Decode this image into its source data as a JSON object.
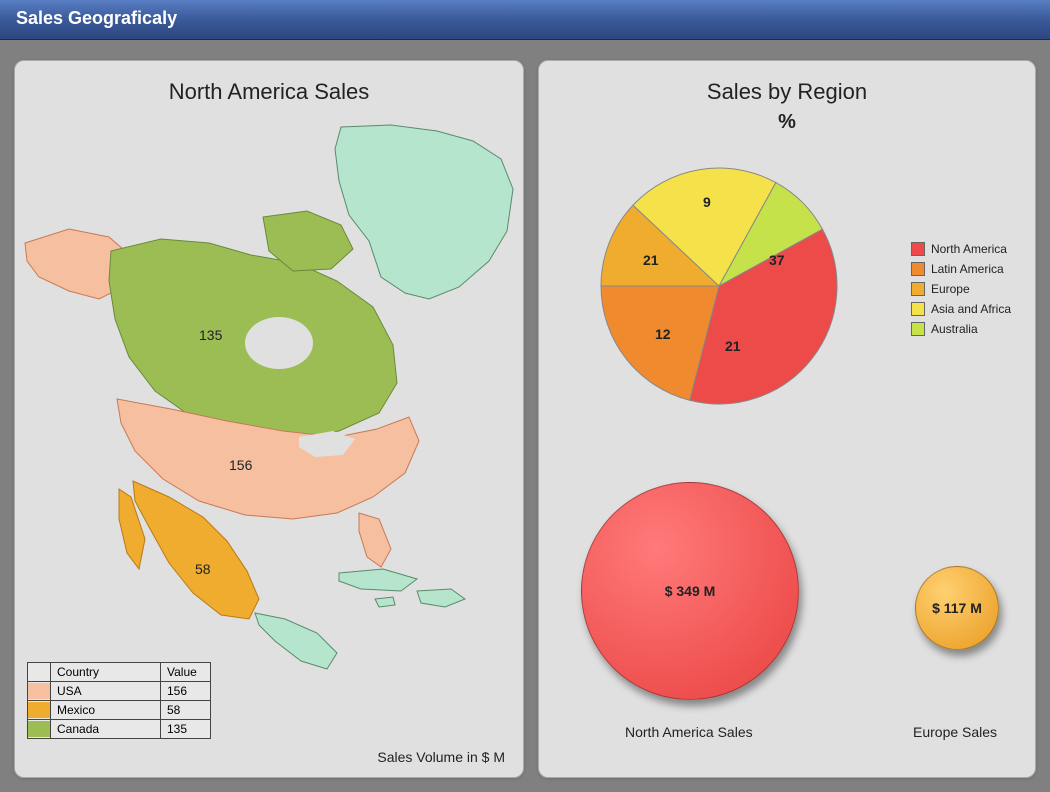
{
  "header": {
    "title": "Sales Geograficaly"
  },
  "map_chart": {
    "title": "North America Sales",
    "caption": "Sales Volume in $ M",
    "countries": [
      {
        "name": "USA",
        "value": 156,
        "color": "#f5bfa0"
      },
      {
        "name": "Mexico",
        "value": 58,
        "color": "#f0ac2e"
      },
      {
        "name": "Canada",
        "value": 135,
        "color": "#9bbd54"
      }
    ],
    "other_color": "#b5e6cd",
    "table_headers": {
      "col1": "Country",
      "col2": "Value"
    }
  },
  "pie_chart": {
    "title": "Sales by Region",
    "subtitle": "%",
    "series": [
      {
        "name": "North America",
        "value": 37,
        "color": "#ed4a4a"
      },
      {
        "name": "Latin America",
        "value": 21,
        "color": "#f08a2e"
      },
      {
        "name": "Europe",
        "value": 12,
        "color": "#f0ac2e"
      },
      {
        "name": "Asia and Africa",
        "value": 21,
        "color": "#f5e24a"
      },
      {
        "name": "Australia",
        "value": 9,
        "color": "#c5e24a"
      }
    ]
  },
  "bubbles": {
    "items": [
      {
        "label": "North America Sales",
        "value_text": "$ 349 M",
        "value": 349,
        "color": "#ed4a4a"
      },
      {
        "label": "Europe Sales",
        "value_text": "$ 117 M",
        "value": 117,
        "color": "#f0ac2e"
      }
    ]
  },
  "chart_data": [
    {
      "type": "map",
      "title": "North America Sales",
      "unit": "Sales Volume in $ M",
      "data": [
        {
          "region": "USA",
          "value": 156
        },
        {
          "region": "Mexico",
          "value": 58
        },
        {
          "region": "Canada",
          "value": 135
        }
      ]
    },
    {
      "type": "pie",
      "title": "Sales by Region %",
      "categories": [
        "North America",
        "Latin America",
        "Europe",
        "Asia and Africa",
        "Australia"
      ],
      "values": [
        37,
        21,
        12,
        21,
        9
      ]
    },
    {
      "type": "bubble",
      "title": "Sales comparison",
      "unit": "$ M",
      "series": [
        {
          "name": "North America Sales",
          "value": 349
        },
        {
          "name": "Europe Sales",
          "value": 117
        }
      ]
    }
  ]
}
